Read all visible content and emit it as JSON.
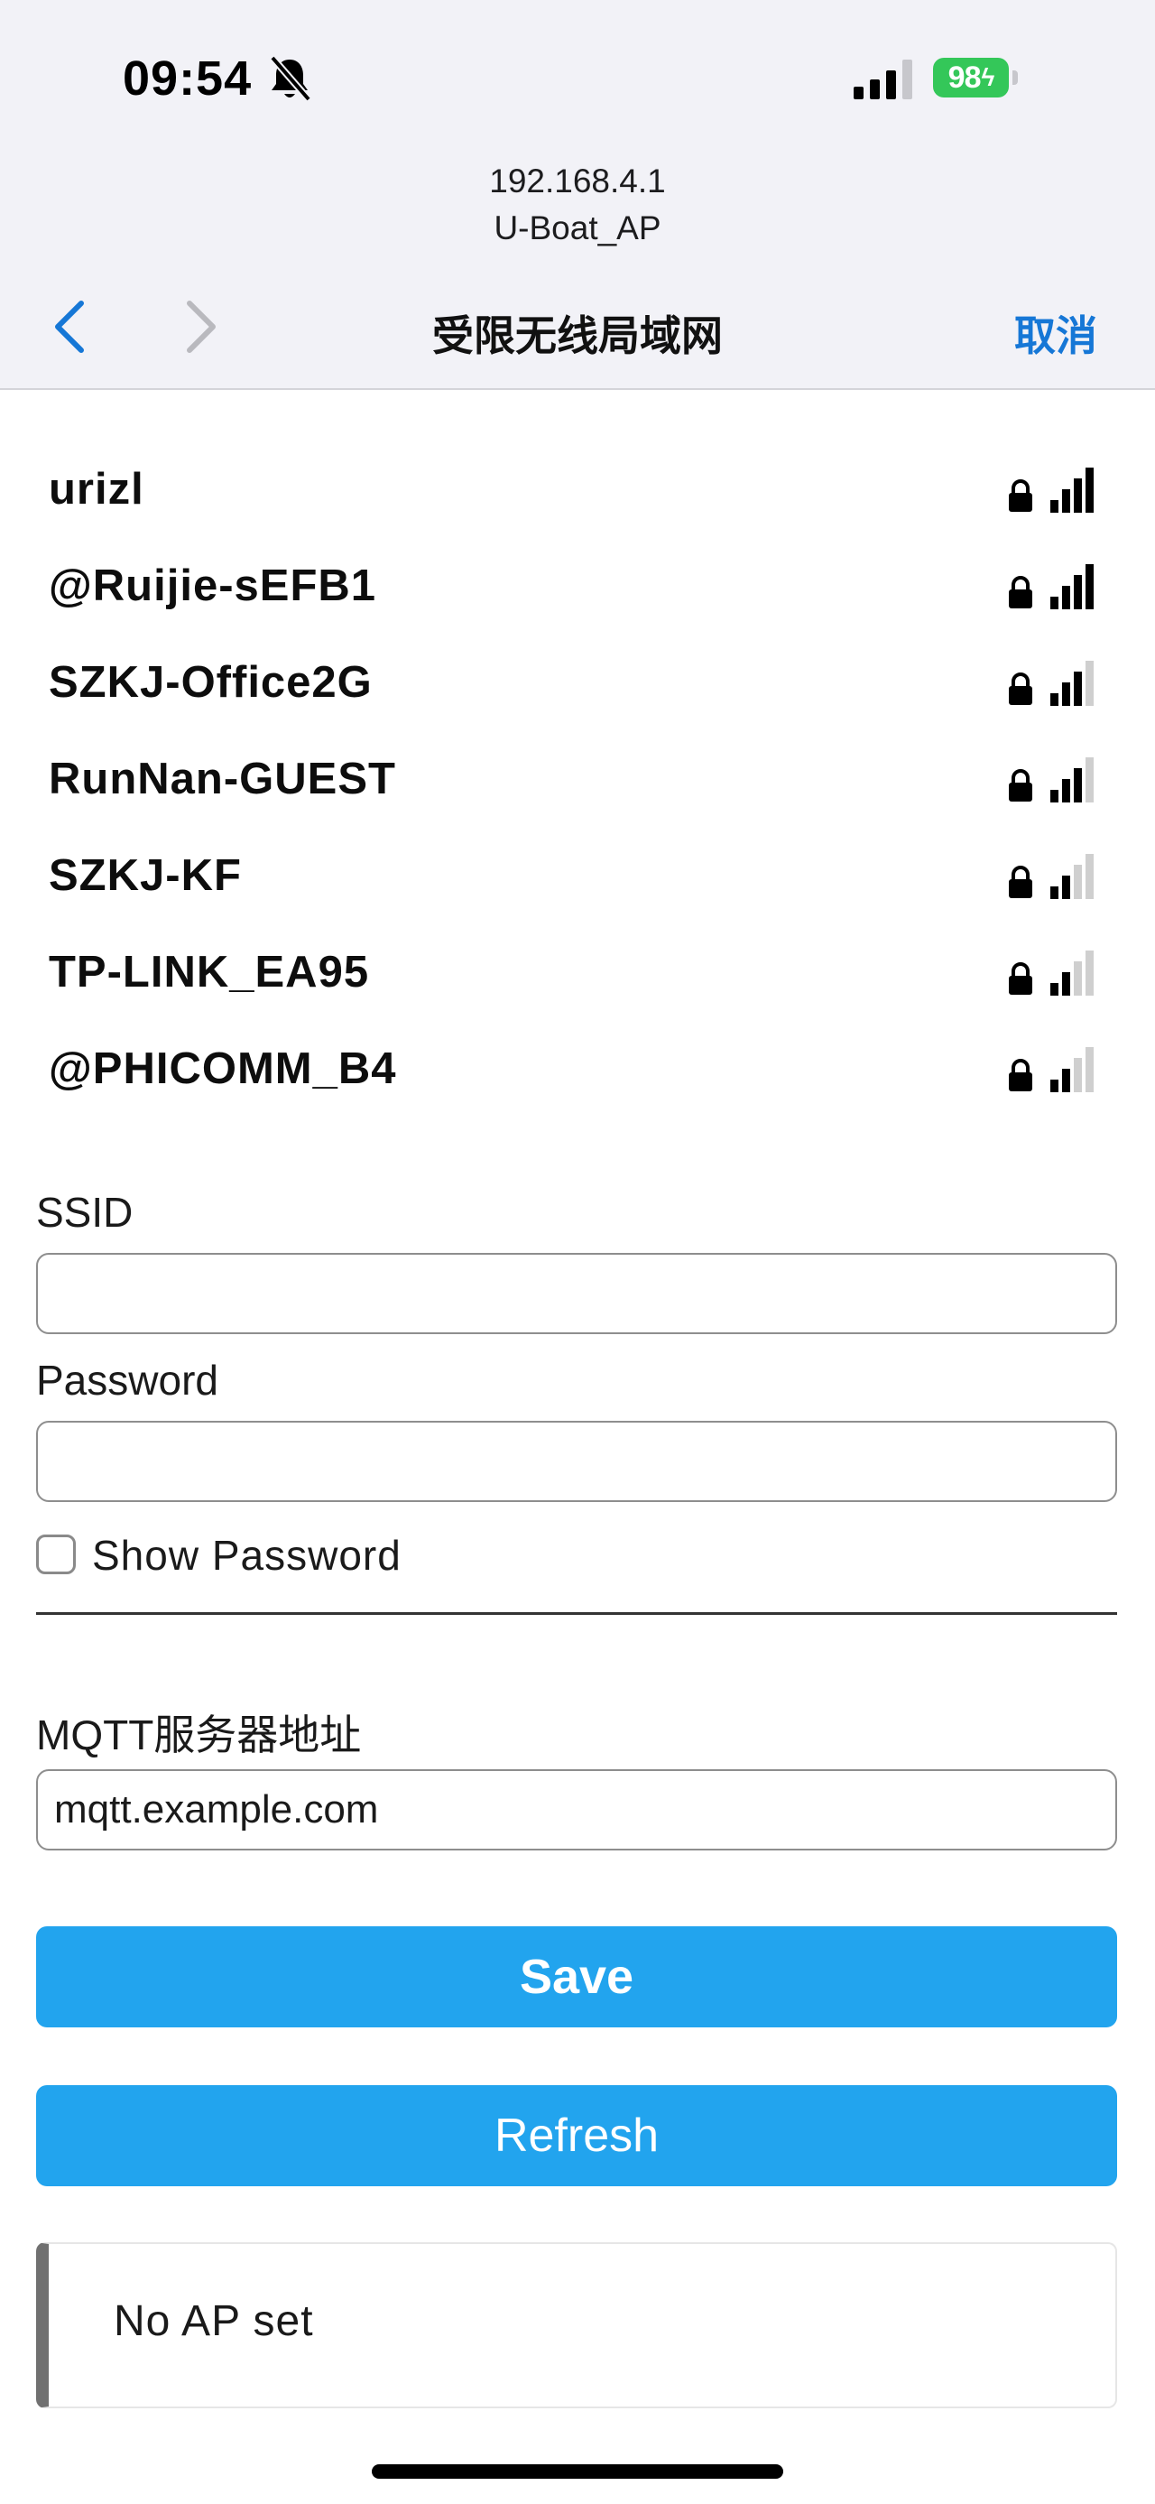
{
  "status_bar": {
    "time": "09:54",
    "battery": "98"
  },
  "browser": {
    "host": "192.168.4.1",
    "ssid_label": "U-Boat_AP",
    "title": "受限无线局域网",
    "cancel": "取消"
  },
  "networks": [
    {
      "name": "urizl",
      "signal": 4,
      "secured": true
    },
    {
      "name": "@Ruijie-sEFB1",
      "signal": 4,
      "secured": true
    },
    {
      "name": "SZKJ-Office2G",
      "signal": 3,
      "secured": true
    },
    {
      "name": "RunNan-GUEST",
      "signal": 3,
      "secured": true
    },
    {
      "name": "SZKJ-KF",
      "signal": 2,
      "secured": true
    },
    {
      "name": "TP-LINK_EA95",
      "signal": 2,
      "secured": true
    },
    {
      "name": "@PHICOMM_B4",
      "signal": 2,
      "secured": true
    }
  ],
  "form": {
    "ssid_label": "SSID",
    "ssid_value": "",
    "password_label": "Password",
    "password_value": "",
    "show_password_label": "Show Password",
    "mqtt_label": "MQTT服务器地址",
    "mqtt_value": "mqtt.example.com"
  },
  "buttons": {
    "save": "Save",
    "refresh": "Refresh"
  },
  "message": "No AP set",
  "colors": {
    "accent": "#22a4ee",
    "link": "#1677d6",
    "battery": "#34c759"
  }
}
